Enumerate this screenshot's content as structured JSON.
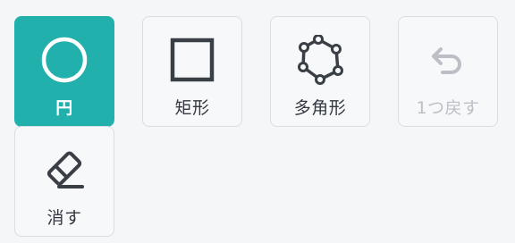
{
  "tools": {
    "circle": {
      "label": "円",
      "icon": "circle-icon",
      "active": true
    },
    "rectangle": {
      "label": "矩形",
      "icon": "square-icon",
      "active": false
    },
    "polygon": {
      "label": "多角形",
      "icon": "polygon-icon",
      "active": false
    },
    "undo": {
      "label": "1つ戻す",
      "icon": "undo-icon",
      "active": false,
      "disabled": true
    },
    "erase": {
      "label": "消す",
      "icon": "eraser-icon",
      "active": false
    }
  },
  "colors": {
    "accent": "#22b0ad",
    "icon": "#3a3f46",
    "disabled": "#bcc0c6",
    "background": "#f5f6f8",
    "button_border": "#dadde3"
  }
}
